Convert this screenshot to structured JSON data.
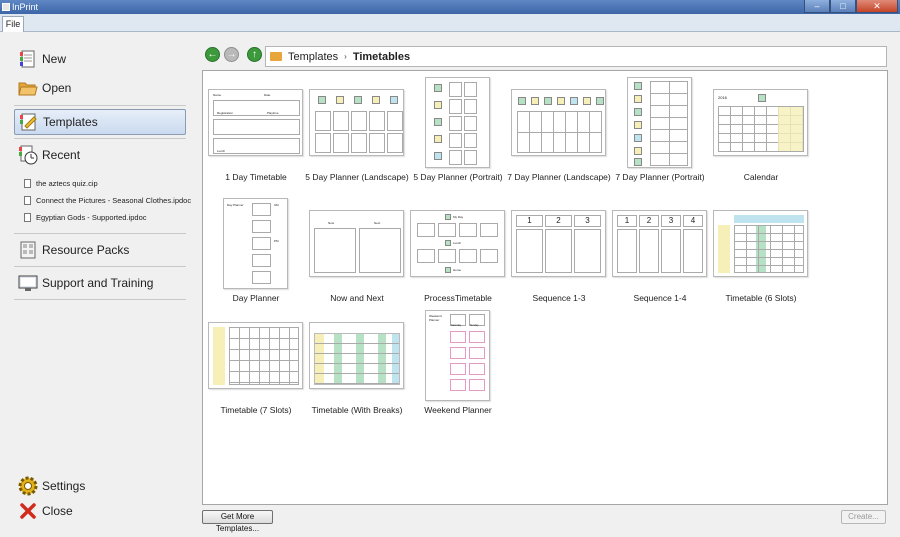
{
  "window": {
    "title": "InPrint"
  },
  "menu": {
    "file_tab": "File"
  },
  "sidebar": {
    "new": "New",
    "open": "Open",
    "templates": "Templates",
    "recent": "Recent",
    "recent_files": [
      "the aztecs quiz.cip",
      "Connect the Pictures - Seasonal Clothes.ipdoc",
      "Egyptian Gods - Supported.ipdoc"
    ],
    "resource_packs": "Resource Packs",
    "support": "Support and Training",
    "settings": "Settings",
    "close": "Close"
  },
  "breadcrumb": {
    "root": "Templates",
    "separator": "›",
    "current": "Timetables"
  },
  "templates": [
    "1 Day Timetable",
    "5 Day Planner (Landscape)",
    "5 Day Planner (Portrait)",
    "7 Day Planner (Landscape)",
    "7 Day Planner (Portrait)",
    "Calendar",
    "Day Planner",
    "Now and Next",
    "ProcessTimetable",
    "Sequence 1-3",
    "Sequence 1-4",
    "Timetable (6 Slots)",
    "Timetable (7 Slots)",
    "Timetable (With Breaks)",
    "Weekend Planner"
  ],
  "thumb_text": {
    "calendar_year": "2016",
    "day_planner_am": "AM",
    "day_planner_pm": "PM",
    "day_planner_title": "Day Planner",
    "now": "Now",
    "next": "Next",
    "process_myday": "My Day",
    "process_lunch": "Lunch",
    "process_home": "Home",
    "seq": [
      "1",
      "2",
      "3",
      "4"
    ],
    "weekend_title": "Weekend Planner",
    "saturday": "Saturday",
    "sunday": "Sunday",
    "one_day_name": "Name",
    "one_day_date": "Date",
    "one_day_register": "Registration",
    "one_day_playtime": "Playtime",
    "one_day_lunch": "Lunch"
  },
  "buttons": {
    "get_more": "Get More Templates...",
    "create": "Create..."
  },
  "colors": {
    "accent_yellow": "#f6f0b8",
    "accent_green": "#b6e1c4",
    "accent_blue": "#bfe3ef",
    "selected": "#cbdaf0"
  }
}
